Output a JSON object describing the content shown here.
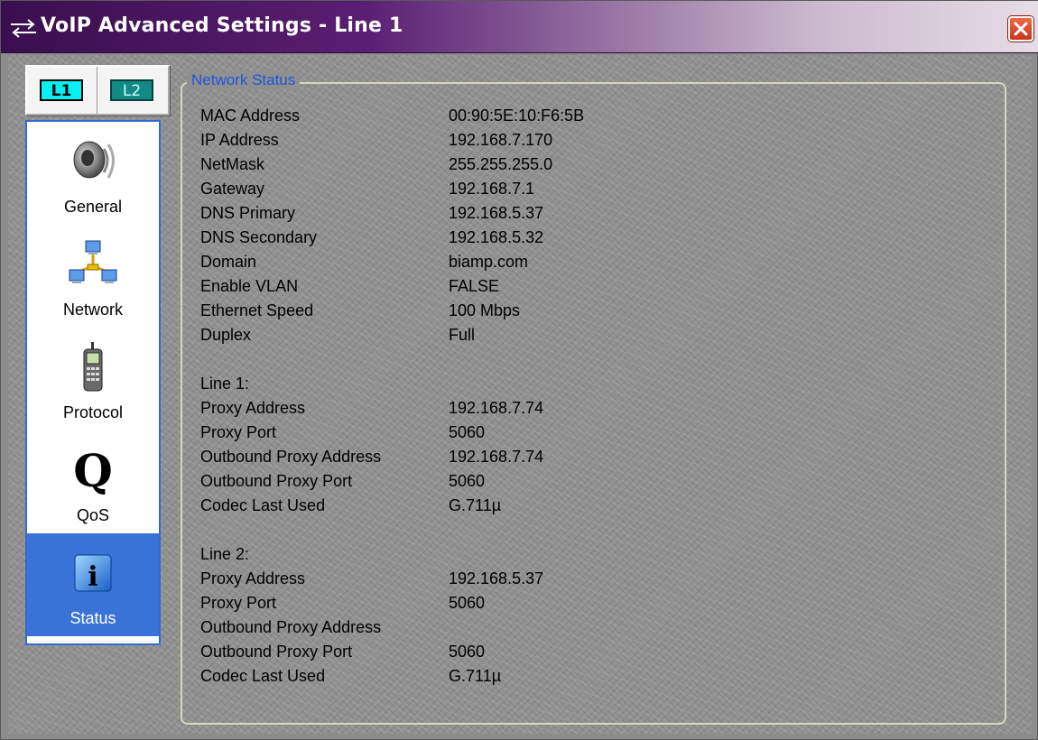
{
  "window": {
    "title": "VoIP Advanced Settings - Line 1"
  },
  "line_tabs": [
    {
      "label": "L1",
      "active": true
    },
    {
      "label": "L2",
      "active": false
    }
  ],
  "nav": [
    {
      "label": "General",
      "icon": "speaker-icon"
    },
    {
      "label": "Network",
      "icon": "network-icon"
    },
    {
      "label": "Protocol",
      "icon": "phone-icon"
    },
    {
      "label": "QoS",
      "icon": "q-icon"
    },
    {
      "label": "Status",
      "icon": "info-icon",
      "selected": true
    }
  ],
  "network_status": {
    "title": "Network Status",
    "general_rows": [
      {
        "label": "MAC Address",
        "value": "00:90:5E:10:F6:5B"
      },
      {
        "label": "IP Address",
        "value": "192.168.7.170"
      },
      {
        "label": "NetMask",
        "value": "255.255.255.0"
      },
      {
        "label": "Gateway",
        "value": "192.168.7.1"
      },
      {
        "label": "DNS Primary",
        "value": "192.168.5.37"
      },
      {
        "label": "DNS Secondary",
        "value": "192.168.5.32"
      },
      {
        "label": "Domain",
        "value": "biamp.com"
      },
      {
        "label": "Enable VLAN",
        "value": "FALSE"
      },
      {
        "label": "Ethernet Speed",
        "value": "100 Mbps"
      },
      {
        "label": "Duplex",
        "value": "Full"
      }
    ],
    "line1": {
      "heading": "Line 1:",
      "rows": [
        {
          "label": "Proxy Address",
          "value": "192.168.7.74"
        },
        {
          "label": "Proxy Port",
          "value": "5060"
        },
        {
          "label": "Outbound Proxy Address",
          "value": "192.168.7.74"
        },
        {
          "label": "Outbound Proxy Port",
          "value": "5060"
        },
        {
          "label": "Codec Last Used",
          "value": "G.711µ"
        }
      ]
    },
    "line2": {
      "heading": "Line 2:",
      "rows": [
        {
          "label": "Proxy Address",
          "value": "192.168.5.37"
        },
        {
          "label": "Proxy Port",
          "value": "5060"
        },
        {
          "label": "Outbound Proxy Address",
          "value": ""
        },
        {
          "label": "Outbound Proxy Port",
          "value": "5060"
        },
        {
          "label": "Codec Last Used",
          "value": "G.711µ"
        }
      ]
    }
  }
}
